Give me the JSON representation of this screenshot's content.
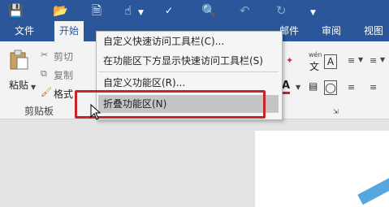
{
  "ribbon_tabs": [
    "文件",
    "开始",
    "审阅",
    "视图"
  ],
  "clipboard": {
    "paste": "粘贴",
    "cut": "剪切",
    "copy": "复制",
    "format_painter": "格式",
    "group_label": "剪贴板"
  },
  "context_menu": {
    "items": [
      "自定义快速访问工具栏(C)...",
      "在功能区下方显示快速访问工具栏(S)",
      "自定义功能区(R)...",
      "折叠功能区(N)"
    ]
  },
  "right_fragments": {
    "wen_top": "wén",
    "wen_bottom": "文",
    "boxed_a": "A",
    "tab_partial": "邮件"
  },
  "colors": {
    "title_bar": "#2b579a",
    "highlight_red": "#c4262e",
    "menu_highlight": "#c5c5c5"
  },
  "icons": [
    "save-icon",
    "open-folder-icon",
    "new-document-icon",
    "touch-mode-icon",
    "spelling-icon",
    "print-preview-icon",
    "undo-icon",
    "redo-icon",
    "dropdown-icon",
    "cursor-icon"
  ]
}
